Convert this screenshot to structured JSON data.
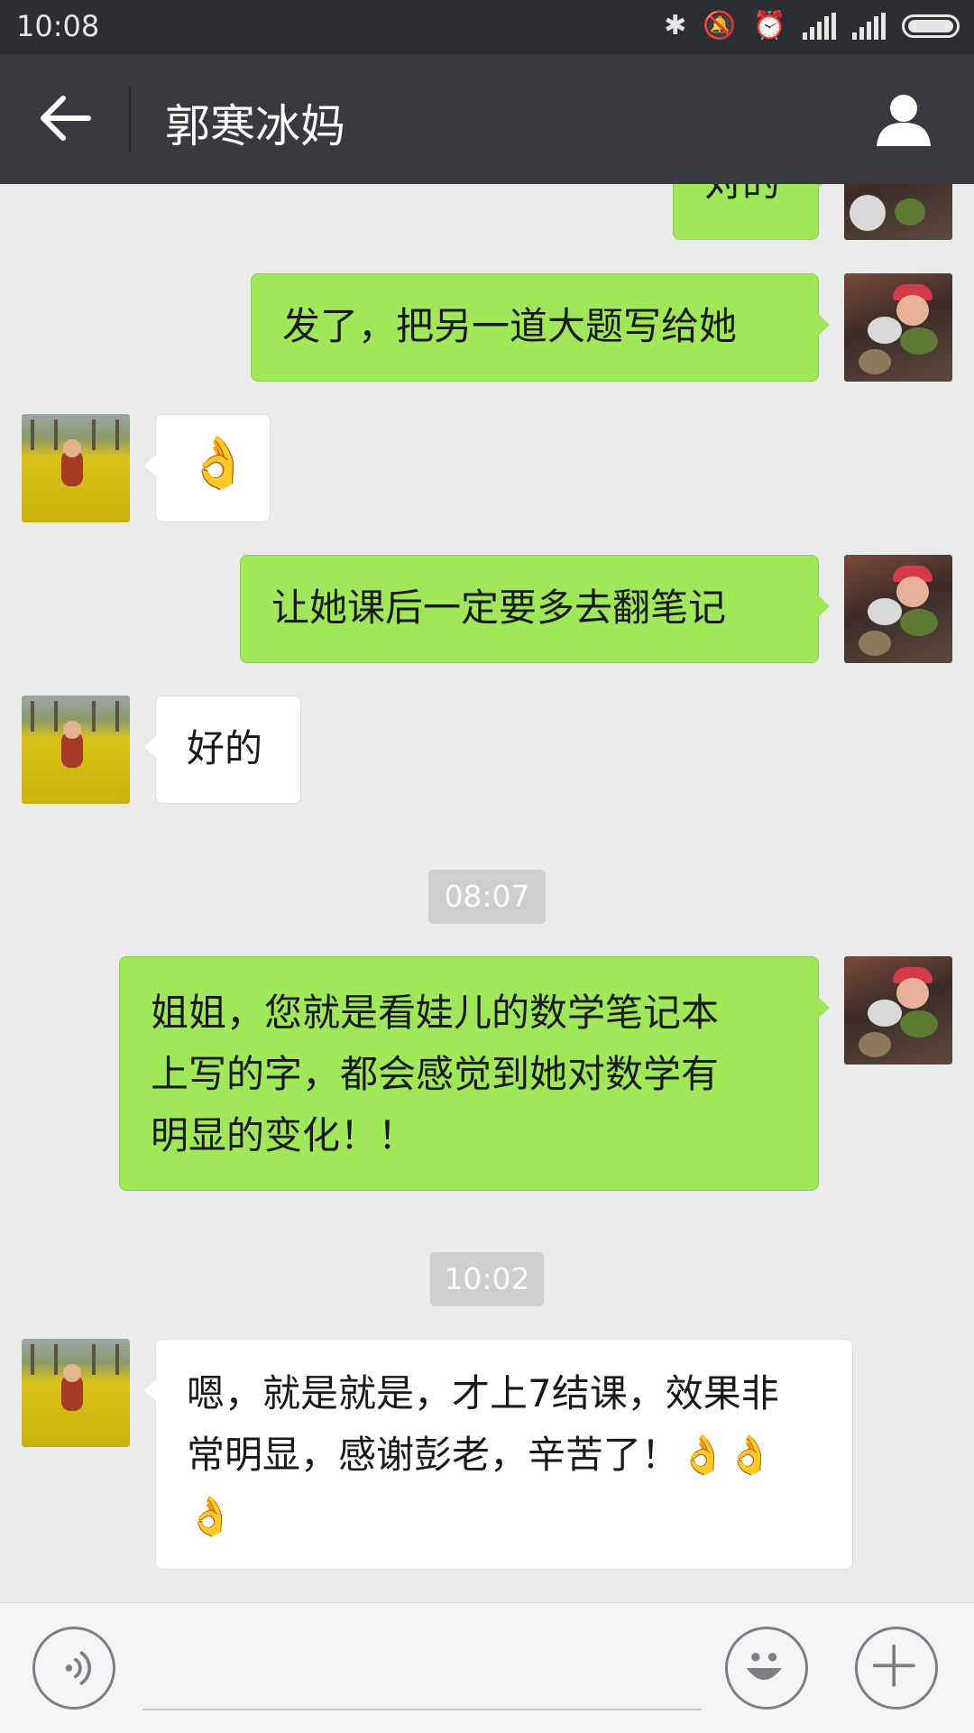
{
  "status_bar": {
    "time": "10:08"
  },
  "header": {
    "title": "郭寒冰妈"
  },
  "messages": [
    {
      "side": "right",
      "text": "对的"
    },
    {
      "side": "right",
      "text": "发了，把另一道大题写给她"
    },
    {
      "side": "left",
      "text": "👌"
    },
    {
      "side": "right",
      "text": "让她课后一定要多去翻笔记"
    },
    {
      "side": "left",
      "text": "好的"
    },
    {
      "timestamp": "08:07"
    },
    {
      "side": "right",
      "lines": [
        "姐姐，您就是看娃儿的数学笔记本",
        "上写的字，都会感觉到她对数学有",
        "明显的变化！！"
      ]
    },
    {
      "timestamp": "10:02"
    },
    {
      "side": "left",
      "lines": [
        "嗯，就是就是，才上7结课，效果非",
        "常明显，感谢彭老，辛苦了！👌👌",
        "👌"
      ]
    }
  ],
  "icons": {
    "back": "arrow-left-icon",
    "profile": "person-icon",
    "voice": "voice-icon",
    "emoji": "smiley-icon",
    "more": "plus-icon"
  }
}
